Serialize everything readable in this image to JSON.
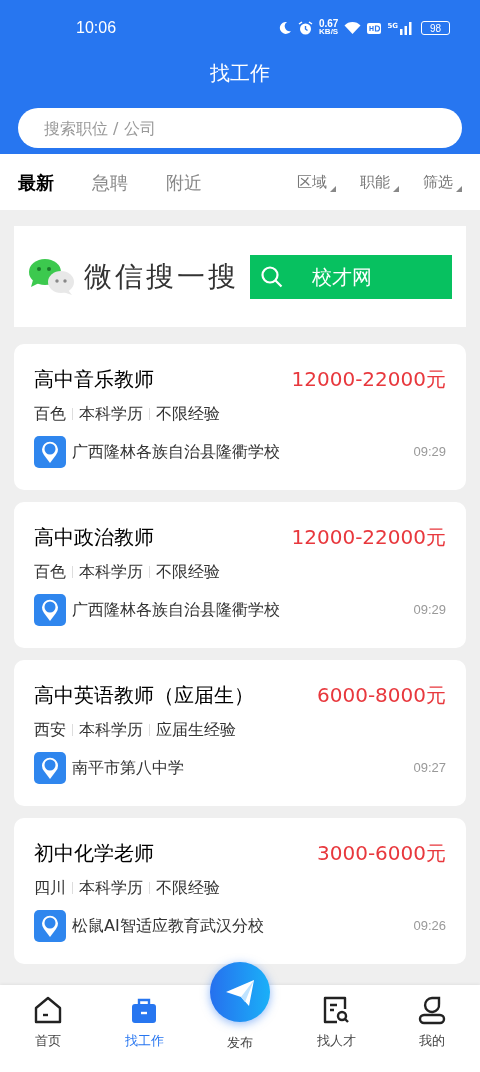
{
  "status_bar": {
    "time": "10:06",
    "speed": "0.67",
    "speed_unit": "KB/S",
    "network": "5G",
    "battery": "98"
  },
  "header": {
    "title": "找工作"
  },
  "search": {
    "placeholder": "搜索职位 / 公司"
  },
  "tabs": [
    {
      "label": "最新",
      "selected": true
    },
    {
      "label": "急聘",
      "selected": false
    },
    {
      "label": "附近",
      "selected": false
    }
  ],
  "filters": [
    "区域",
    "职能",
    "筛选"
  ],
  "banner": {
    "text": "微信搜一搜",
    "button": "校才网"
  },
  "jobs": [
    {
      "title": "高中音乐教师",
      "salary": "12000-22000元",
      "tags": [
        "百色",
        "本科学历",
        "不限经验"
      ],
      "company": "广西隆林各族自治县隆衢学校",
      "time": "09:29"
    },
    {
      "title": "高中政治教师",
      "salary": "12000-22000元",
      "tags": [
        "百色",
        "本科学历",
        "不限经验"
      ],
      "company": "广西隆林各族自治县隆衢学校",
      "time": "09:29"
    },
    {
      "title": "高中英语教师（应届生）",
      "salary": "6000-8000元",
      "tags": [
        "西安",
        "本科学历",
        "应届生经验"
      ],
      "company": "南平市第八中学",
      "time": "09:27"
    },
    {
      "title": "初中化学老师",
      "salary": "3000-6000元",
      "tags": [
        "四川",
        "本科学历",
        "不限经验"
      ],
      "company": "松鼠AI智适应教育武汉分校",
      "time": "09:26"
    }
  ],
  "nav": [
    {
      "kind": "home",
      "label": "首页",
      "selected": false
    },
    {
      "kind": "briefcase",
      "label": "找工作",
      "selected": true
    },
    {
      "kind": "publish",
      "label": "发布",
      "selected": false
    },
    {
      "kind": "talent",
      "label": "找人才",
      "selected": false
    },
    {
      "kind": "profile",
      "label": "我的",
      "selected": false
    }
  ]
}
